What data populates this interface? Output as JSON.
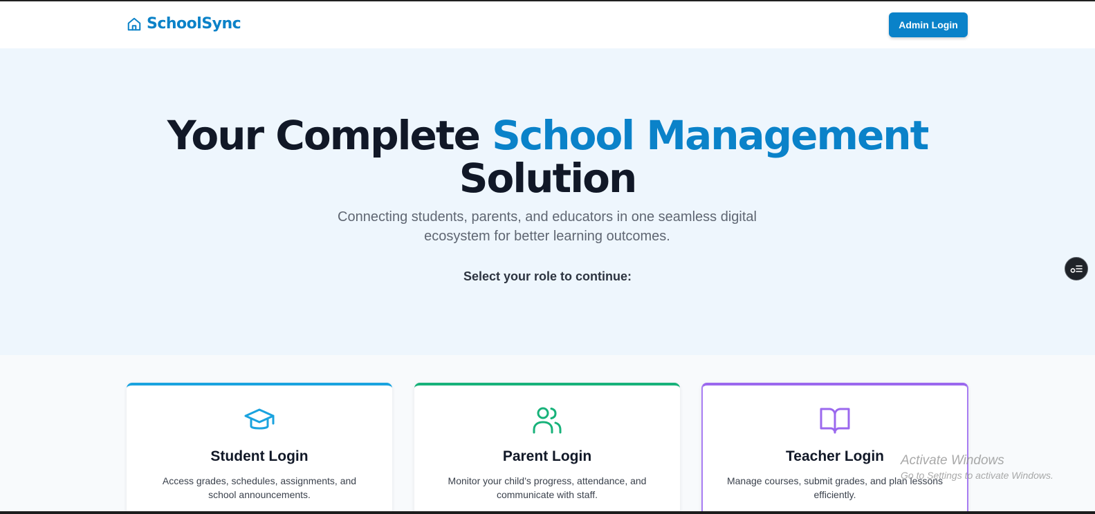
{
  "header": {
    "brand_name": "SchoolSync",
    "brand_icon": "home-icon",
    "admin_login_label": "Admin Login"
  },
  "hero": {
    "title_part1": "Your Complete ",
    "title_accent": "School Management",
    "title_part2": "Solution",
    "subtitle": "Connecting students, parents, and educators in one seamless digital ecosystem for better learning outcomes.",
    "prompt": "Select your role to continue:"
  },
  "cards": [
    {
      "title": "Student Login",
      "description": "Access grades, schedules, assignments, and school announcements.",
      "icon": "graduation-cap-icon",
      "color": "#1aa3df"
    },
    {
      "title": "Parent Login",
      "description": "Monitor your child’s progress, attendance, and communicate with staff.",
      "icon": "users-icon",
      "color": "#18b27a"
    },
    {
      "title": "Teacher Login",
      "description": "Manage courses, submit grades, and plan lessons efficiently.",
      "icon": "book-open-icon",
      "color": "#9b68ee"
    }
  ],
  "floating_button_icon": "settings-list-icon",
  "watermark": {
    "title": "Activate Windows",
    "subtitle": "Go to Settings to activate Windows."
  },
  "colors": {
    "brand": "#0a82c9",
    "hero_background": "#eef6fd",
    "heading": "#111827"
  }
}
